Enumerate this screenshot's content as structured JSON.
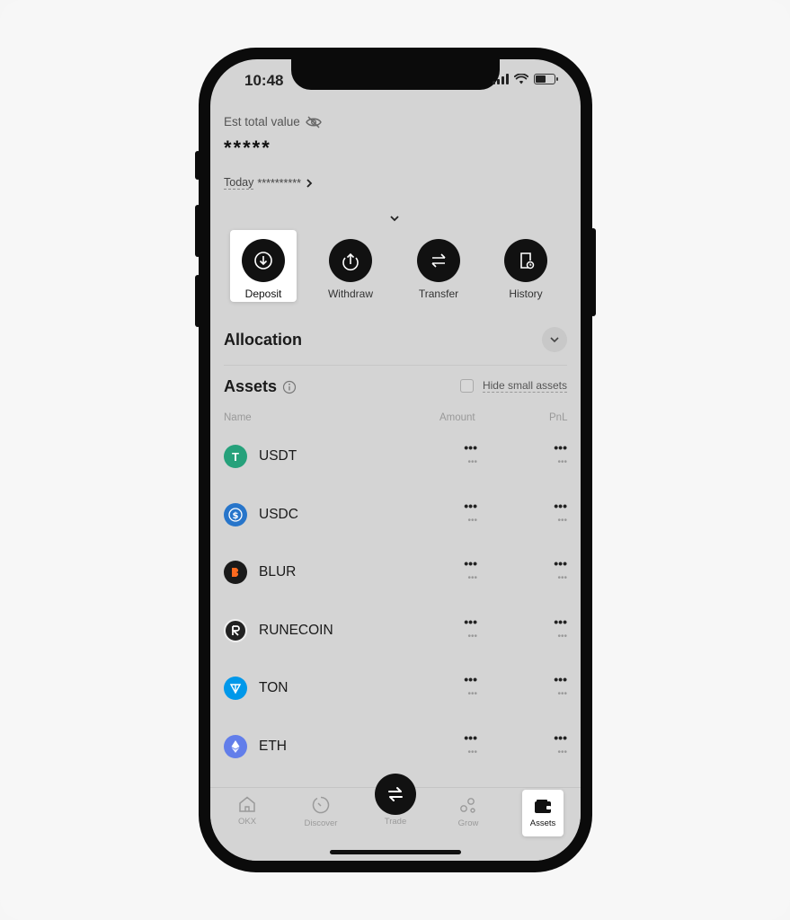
{
  "status_bar": {
    "time": "10:48"
  },
  "header": {
    "est_label": "Est total value",
    "est_value": "*****",
    "today_label": "Today",
    "today_value": "**********"
  },
  "actions": [
    {
      "label": "Deposit",
      "icon": "arrow-down-circle-icon",
      "highlighted": true
    },
    {
      "label": "Withdraw",
      "icon": "arrow-up-circle-icon"
    },
    {
      "label": "Transfer",
      "icon": "swap-arrows-icon"
    },
    {
      "label": "History",
      "icon": "history-doc-icon"
    }
  ],
  "allocation": {
    "title": "Allocation"
  },
  "assets": {
    "title": "Assets",
    "hide_small": "Hide small assets",
    "columns": {
      "name": "Name",
      "amount": "Amount",
      "pnl": "PnL"
    },
    "rows": [
      {
        "name": "USDT",
        "amount": "•••",
        "amount_sub": "•••",
        "pnl": "•••",
        "pnl_sub": "•••",
        "color": "#26a17b"
      },
      {
        "name": "USDC",
        "amount": "•••",
        "amount_sub": "•••",
        "pnl": "•••",
        "pnl_sub": "•••",
        "color": "#2775ca"
      },
      {
        "name": "BLUR",
        "amount": "•••",
        "amount_sub": "•••",
        "pnl": "•••",
        "pnl_sub": "•••",
        "color": "#ff6a1f"
      },
      {
        "name": "RUNECOIN",
        "amount": "•••",
        "amount_sub": "•••",
        "pnl": "•••",
        "pnl_sub": "•••",
        "color": "#222222"
      },
      {
        "name": "TON",
        "amount": "•••",
        "amount_sub": "•••",
        "pnl": "•••",
        "pnl_sub": "•••",
        "color": "#0098ea"
      },
      {
        "name": "ETH",
        "amount": "•••",
        "amount_sub": "•••",
        "pnl": "•••",
        "pnl_sub": "•••",
        "color": "#627eea"
      }
    ]
  },
  "tabbar": {
    "items": [
      {
        "label": "OKX",
        "icon": "home-icon"
      },
      {
        "label": "Discover",
        "icon": "discover-icon"
      },
      {
        "label": "Trade",
        "icon": "trade-swap-icon"
      },
      {
        "label": "Grow",
        "icon": "grow-icon"
      },
      {
        "label": "Assets",
        "icon": "wallet-icon",
        "active": true
      }
    ]
  }
}
